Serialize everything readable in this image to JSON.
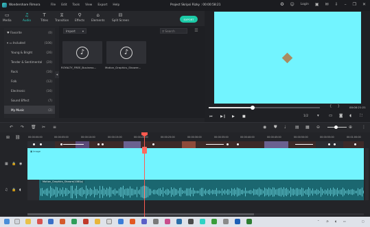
{
  "app": {
    "name": "Wondershare Filmora",
    "menu": [
      "File",
      "Edit",
      "Tools",
      "View",
      "Export",
      "Help"
    ],
    "project_title": "Project Skripsi Rizky : 00:00:58:21",
    "login": "Login"
  },
  "toolbar": {
    "tabs": [
      {
        "label": "Media",
        "icon": "folder-icon"
      },
      {
        "label": "Audio",
        "icon": "music-icon"
      },
      {
        "label": "Titles",
        "icon": "titles-icon"
      },
      {
        "label": "Transition",
        "icon": "transition-icon"
      },
      {
        "label": "Effects",
        "icon": "effects-icon"
      },
      {
        "label": "Elements",
        "icon": "elements-icon"
      },
      {
        "label": "Split Screen",
        "icon": "split-screen-icon"
      }
    ],
    "active_tab": "Audio",
    "export_label": "EXPORT"
  },
  "sidebar": {
    "items": [
      {
        "label": "Favorite",
        "count": "(0)"
      },
      {
        "label": "Included",
        "count": "(106)"
      },
      {
        "label": "Young & Bright",
        "count": "(26)"
      },
      {
        "label": "Tender & Sentimental",
        "count": "(20)"
      },
      {
        "label": "Rock",
        "count": "(16)"
      },
      {
        "label": "Folk",
        "count": "(12)"
      },
      {
        "label": "Electronic",
        "count": "(16)"
      },
      {
        "label": "Sound Effect",
        "count": "(7)"
      },
      {
        "label": "My Music",
        "count": "(2)"
      }
    ],
    "active_item": "My Music"
  },
  "media": {
    "import_label": "Import",
    "search_placeholder": "Search",
    "items": [
      {
        "label": "ROYALTY_FREE_Business..."
      },
      {
        "label": "Motion_Graphics_Showre..."
      }
    ]
  },
  "preview": {
    "background_color": "#72f4ff",
    "timecode": "00:00:21:21",
    "ratio": "1/2",
    "progress": 0.39
  },
  "timeline": {
    "ruler_ticks": [
      "00:00:00:00",
      "00:00:05:00",
      "00:00:10:00",
      "00:00:15:00",
      "00:00:20:00",
      "00:00:25:00",
      "00:00:30:00",
      "00:00:35:00",
      "00:00:40:00",
      "00:00:45:00",
      "00:00:50:00",
      "00:00:55:00",
      "00:01:00:00"
    ],
    "video_clip_label": "Image",
    "audio_clip_label": "Motion_Graphics_Showre(1080p)",
    "playhead_time": "00:00:21:21"
  },
  "colors": {
    "accent": "#2dd3c4",
    "export": "#1ccaa7",
    "playhead": "#ff5a4f",
    "audio_clip": "#1b6770"
  }
}
